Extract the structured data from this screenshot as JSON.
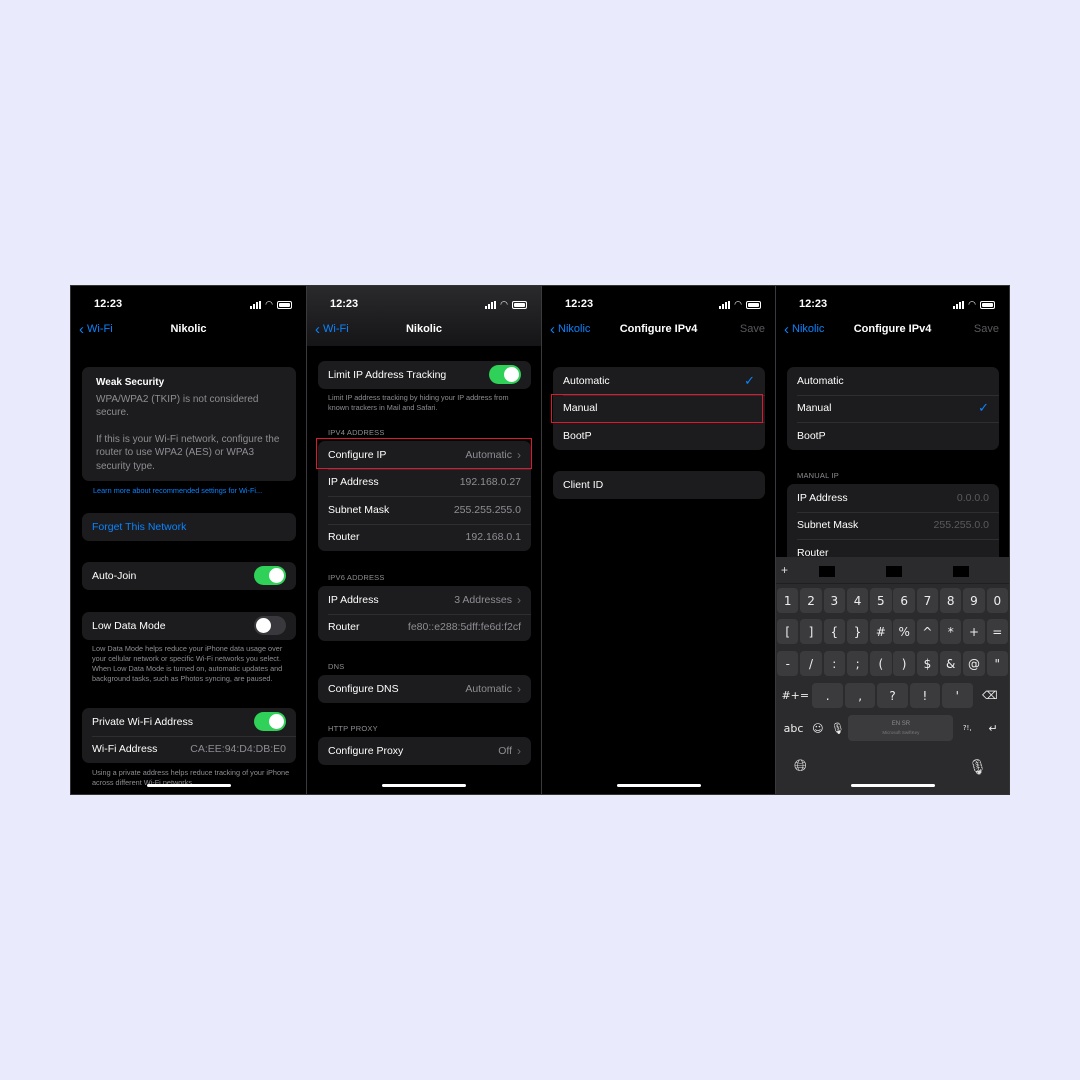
{
  "status_time": "12:23",
  "colors": {
    "background": "#e9ebfd",
    "accent": "#0a84ff",
    "toggle_on": "#30d158",
    "highlight": "#e0182d"
  },
  "p1": {
    "back": "Wi-Fi",
    "title": "Nikolic",
    "warning_title": "Weak Security",
    "warning_line1": "WPA/WPA2 (TKIP) is not considered secure.",
    "warning_line2": "If this is your Wi-Fi network, configure the router to use WPA2 (AES) or WPA3 security type.",
    "learn_more": "Learn more about recommended settings for Wi-Fi...",
    "forget": "Forget This Network",
    "auto_join": "Auto-Join",
    "auto_join_on": true,
    "low_data": "Low Data Mode",
    "low_data_on": false,
    "low_data_footer": "Low Data Mode helps reduce your iPhone data usage over your cellular network or specific Wi-Fi networks you select. When Low Data Mode is turned on, automatic updates and background tasks, such as Photos syncing, are paused.",
    "private_addr": "Private Wi-Fi Address",
    "private_addr_on": true,
    "wifi_addr_label": "Wi-Fi Address",
    "wifi_addr": "CA:EE:94:D4:DB:E0",
    "private_footer": "Using a private address helps reduce tracking of your iPhone across different Wi-Fi networks."
  },
  "p2": {
    "back": "Wi-Fi",
    "title": "Nikolic",
    "limit": "Limit IP Address Tracking",
    "limit_on": true,
    "limit_footer": "Limit IP address tracking by hiding your IP address from known trackers in Mail and Safari.",
    "ipv4_header": "IPV4 ADDRESS",
    "ipv4": [
      {
        "label": "Configure IP",
        "value": "Automatic"
      },
      {
        "label": "IP Address",
        "value": "192.168.0.27"
      },
      {
        "label": "Subnet Mask",
        "value": "255.255.255.0"
      },
      {
        "label": "Router",
        "value": "192.168.0.1"
      }
    ],
    "ipv6_header": "IPV6 ADDRESS",
    "ipv6": [
      {
        "label": "IP Address",
        "value": "3 Addresses"
      },
      {
        "label": "Router",
        "value": "fe80::e288:5dff:fe6d:f2cf"
      }
    ],
    "dns_header": "DNS",
    "dns": {
      "label": "Configure DNS",
      "value": "Automatic"
    },
    "proxy_header": "HTTP PROXY",
    "proxy": {
      "label": "Configure Proxy",
      "value": "Off"
    }
  },
  "p3": {
    "back": "Nikolic",
    "title": "Configure IPv4",
    "save": "Save",
    "options": [
      "Automatic",
      "Manual",
      "BootP"
    ],
    "selected": "Automatic",
    "client_id": "Client ID"
  },
  "p4": {
    "back": "Nikolic",
    "title": "Configure IPv4",
    "save": "Save",
    "options": [
      "Automatic",
      "Manual",
      "BootP"
    ],
    "selected": "Manual",
    "manual_header": "MANUAL IP",
    "fields": [
      {
        "label": "IP Address",
        "placeholder": "0.0.0.0"
      },
      {
        "label": "Subnet Mask",
        "placeholder": "255.255.0.0"
      },
      {
        "label": "Router",
        "placeholder": ""
      }
    ],
    "keyboard": {
      "row1": [
        "1",
        "2",
        "3",
        "4",
        "5",
        "6",
        "7",
        "8",
        "9",
        "0"
      ],
      "row2": [
        "[",
        "]",
        "{",
        "}",
        "#",
        "%",
        "^",
        "*",
        "+",
        "="
      ],
      "row3": [
        "-",
        "/",
        ":",
        ";",
        "(",
        ")",
        "$",
        "&",
        "@",
        "\""
      ],
      "row4": [
        ".",
        ",",
        "?",
        "!",
        "'"
      ],
      "shift_label": "#+=",
      "abc": "abc",
      "space_line1": "EN SR",
      "space_line2": "Microsoft SwiftKey",
      "punct": "?!,"
    }
  }
}
